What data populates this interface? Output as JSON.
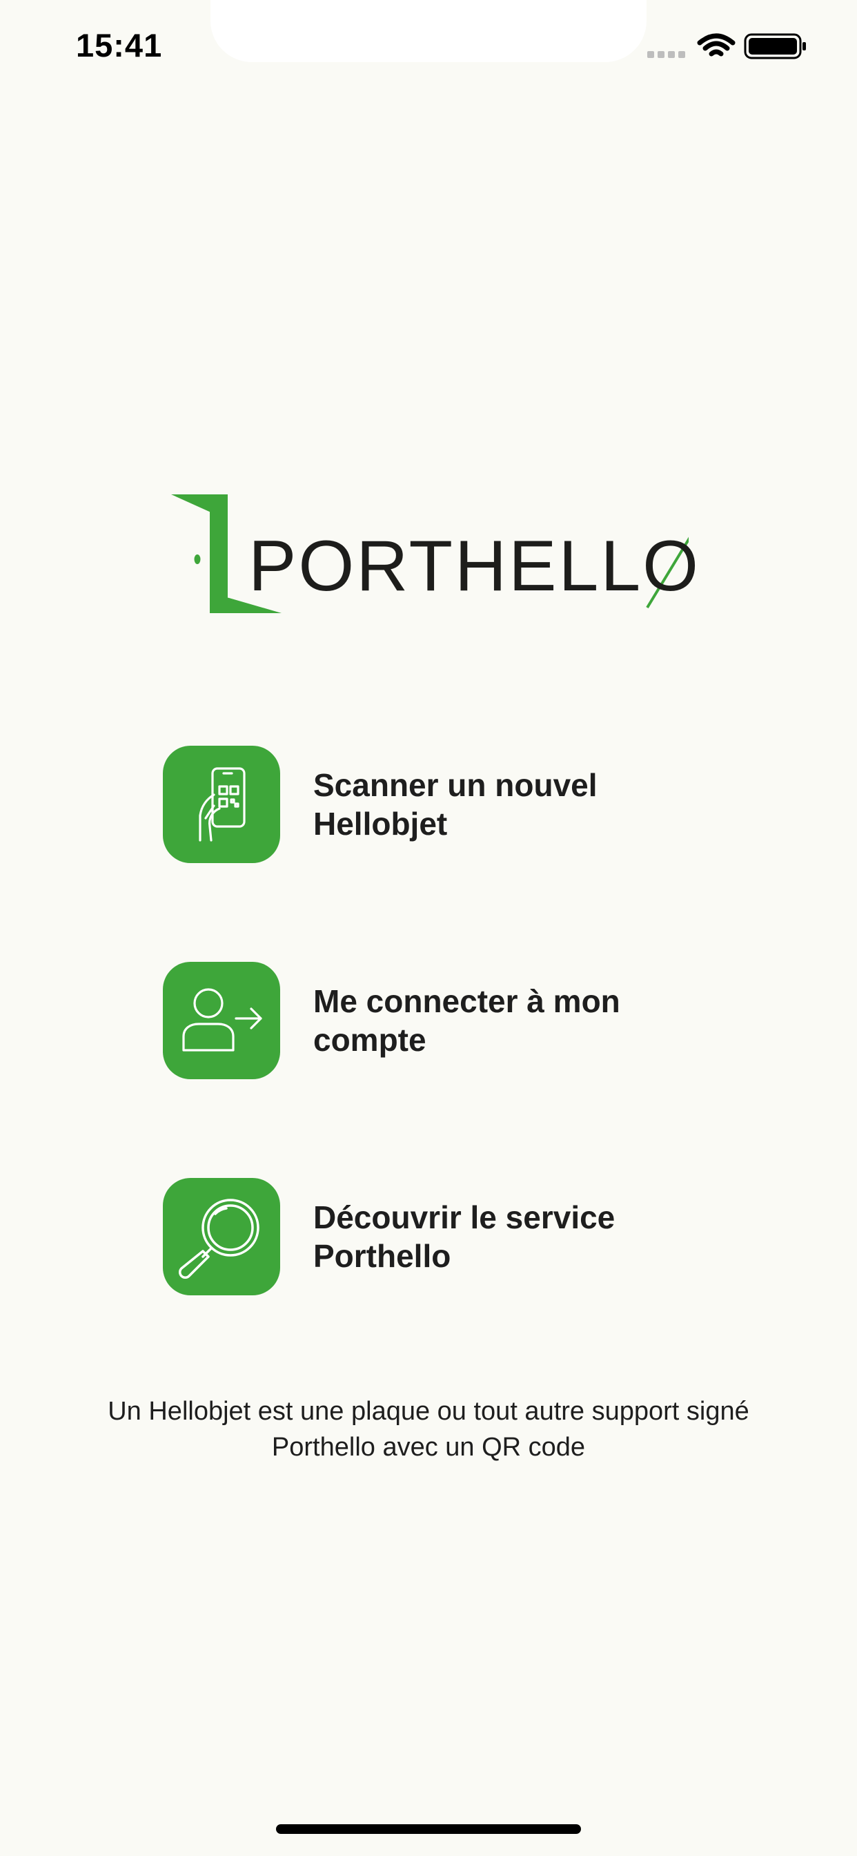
{
  "status_bar": {
    "time": "15:41",
    "icons": [
      "signal-icon",
      "wifi-icon",
      "battery-icon"
    ]
  },
  "logo": {
    "text": "PORTHELLO",
    "brand_color": "#3EA63A"
  },
  "menu": [
    {
      "label": "Scanner un nouvel Hellobjet",
      "icon": "phone-qr-scan-icon"
    },
    {
      "label": "Me connecter à mon compte",
      "icon": "user-login-icon"
    },
    {
      "label": "Découvrir le service Porthello",
      "icon": "magnifier-icon"
    }
  ],
  "footnote": "Un Hellobjet est une plaque ou tout autre support signé Porthello avec un QR code",
  "colors": {
    "accent": "#3EA63A",
    "background": "#FAFAF5",
    "text": "#1E1E1E"
  }
}
